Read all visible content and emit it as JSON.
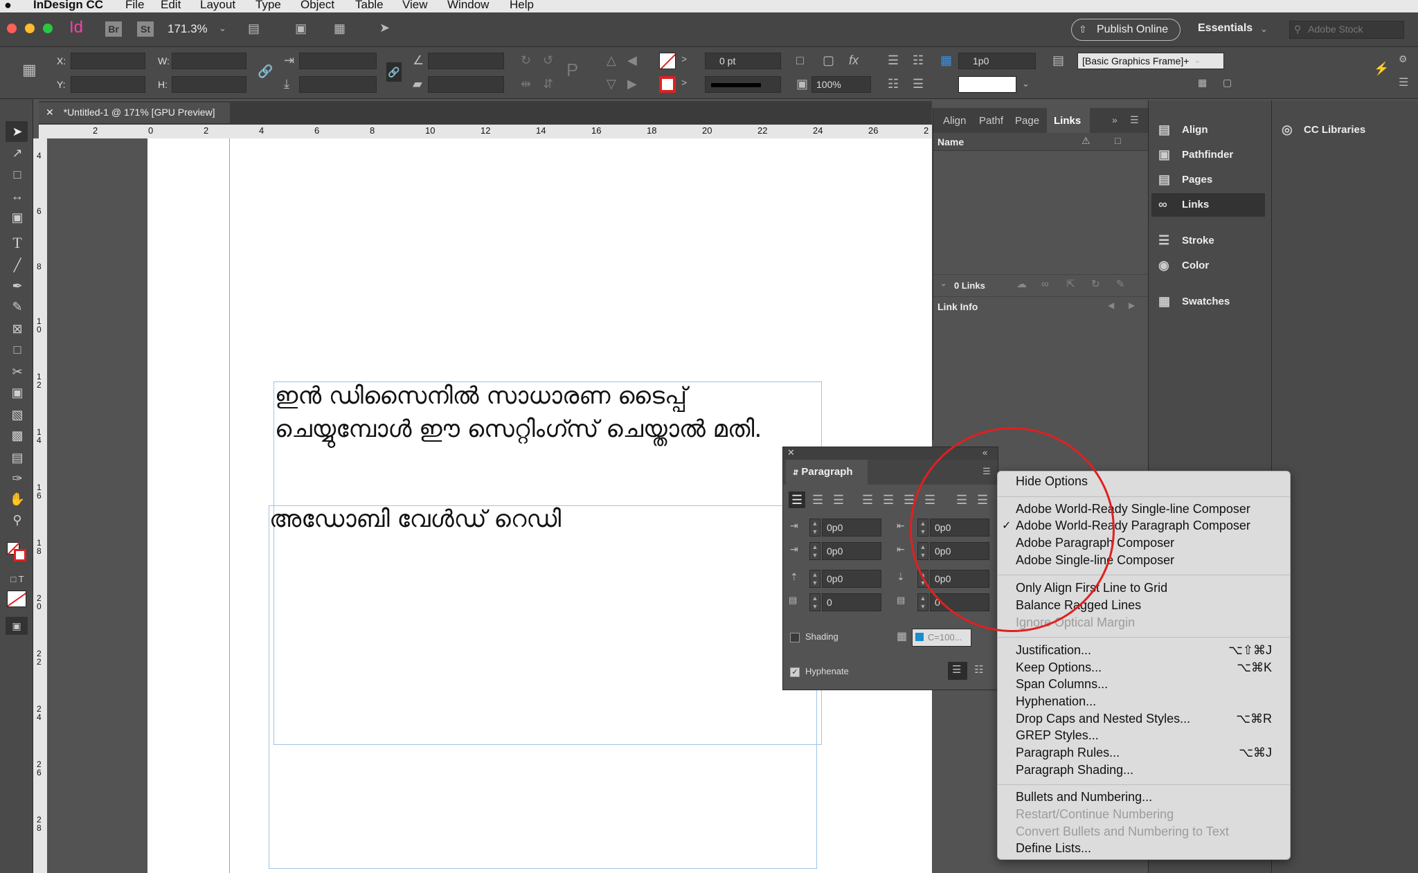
{
  "menubar": {
    "app": "InDesign CC",
    "items": [
      "File",
      "Edit",
      "Layout",
      "Type",
      "Object",
      "Table",
      "View",
      "Window",
      "Help"
    ]
  },
  "appbar": {
    "logo": "Id",
    "bridge": "Br",
    "stock": "St",
    "zoom": "171.3%",
    "publish": "Publish Online",
    "workspace": "Essentials",
    "search_placeholder": "Adobe Stock"
  },
  "control": {
    "x_label": "X:",
    "y_label": "Y:",
    "w_label": "W:",
    "h_label": "H:",
    "stroke_weight": "0 pt",
    "opacity": "100%",
    "gap": "1p0",
    "object_style": "[Basic Graphics Frame]+"
  },
  "document": {
    "tab_title": "*Untitled-1 @ 171% [GPU Preview]",
    "ruler_h": [
      "2",
      "0",
      "2",
      "4",
      "6",
      "8",
      "10",
      "12",
      "14",
      "16",
      "18",
      "20",
      "22",
      "24",
      "26",
      "2"
    ],
    "ruler_v": [
      "4",
      "6",
      "8",
      "10",
      "12",
      "14",
      "16",
      "18",
      "20",
      "22",
      "24",
      "26",
      "28"
    ],
    "text1_line1": "ഇൻ ഡിസൈനിൽ സാധാരണ ടൈപ്പ്",
    "text1_line2": "ചെയ്യുമ്പോൾ ഈ സെറ്റിംഗ്സ് ചെയ്താൽ മതി.",
    "text2": "അഡോബി വേൾഡ് റെഡി"
  },
  "links_panel": {
    "tabs": [
      "Align",
      "Pathf",
      "Page",
      "Links"
    ],
    "col_name": "Name",
    "count": "0 Links",
    "link_info": "Link Info"
  },
  "dock": {
    "items": [
      "Align",
      "Pathfinder",
      "Pages",
      "Links",
      "Stroke",
      "Color",
      "Swatches"
    ],
    "cc_libraries": "CC Libraries"
  },
  "paragraph_panel": {
    "title": "Paragraph",
    "fields": [
      "0p0",
      "0p0",
      "0p0",
      "0p0",
      "0p0",
      "0p0",
      "0",
      "0"
    ],
    "shading_label": "Shading",
    "shading_color": "C=100...",
    "hyphenate_label": "Hyphenate"
  },
  "context_menu": {
    "hide_options": "Hide Options",
    "composers": [
      "Adobe World-Ready Single-line Composer",
      "Adobe World-Ready Paragraph Composer",
      "Adobe Paragraph Composer",
      "Adobe Single-line Composer"
    ],
    "checked_index": 1,
    "grid": [
      "Only Align First Line to Grid",
      "Balance Ragged Lines",
      "Ignore Optical Margin"
    ],
    "dialogs": [
      {
        "label": "Justification...",
        "shortcut": "⌥⇧⌘J"
      },
      {
        "label": "Keep Options...",
        "shortcut": "⌥⌘K"
      },
      {
        "label": "Span Columns...",
        "shortcut": ""
      },
      {
        "label": "Hyphenation...",
        "shortcut": ""
      },
      {
        "label": "Drop Caps and Nested Styles...",
        "shortcut": "⌥⌘R"
      },
      {
        "label": "GREP Styles...",
        "shortcut": ""
      },
      {
        "label": "Paragraph Rules...",
        "shortcut": "⌥⌘J"
      },
      {
        "label": "Paragraph Shading...",
        "shortcut": ""
      }
    ],
    "lists": [
      "Bullets and Numbering...",
      "Restart/Continue Numbering",
      "Convert Bullets and Numbering to Text",
      "Define Lists..."
    ]
  },
  "colors": {
    "annotation_circle": "#e02020",
    "frame_border": "#9fc3e6",
    "app_logo": "#ff3daa"
  }
}
